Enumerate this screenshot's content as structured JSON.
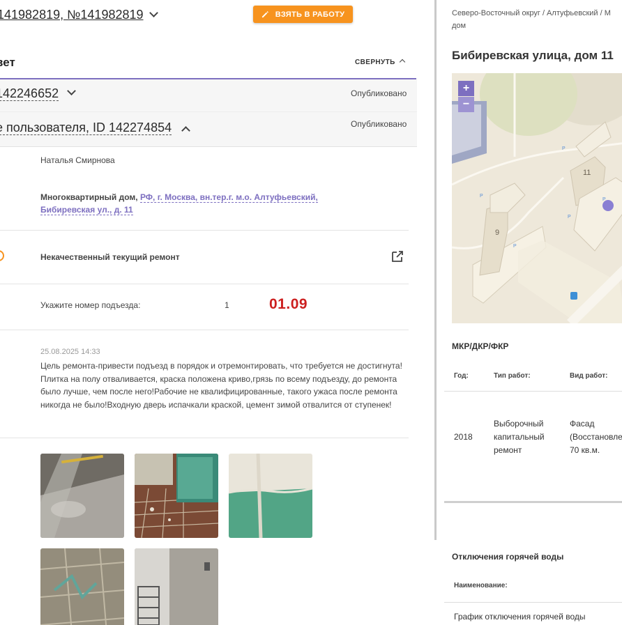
{
  "header": {
    "title": "141982819, №141982819",
    "take_button": "ВЗЯТЬ В РАБОТУ"
  },
  "section": {
    "title": "вет",
    "collapse_label": "СВЕРНУТЬ"
  },
  "items": [
    {
      "id_text": "142246652",
      "status": "Опубликовано"
    },
    {
      "id_text": "е пользователя, ID 142274854",
      "status": "Опубликовано"
    }
  ],
  "details": {
    "author": "Наталья Смирнова",
    "object_type": "Многоквартирный дом,",
    "address_line1": "РФ, г. Москва, вн.тер.г. м.о. Алтуфьевский,",
    "address_line2": "Бибиревская ул., д. 11",
    "category": "Некачественный текущий ремонт",
    "entrance_question": "Укажите номер подъезда:",
    "entrance_answer": "1",
    "stamp": "01.09",
    "comment_date": "25.08.2025 14:33",
    "comment_text": "Цель ремонта-привести подъезд в порядок и отремонтировать, что требуется не достигнута!Плитка на полу отваливается, краска положена криво,грязь по всему подъезду, до ремонта было лучше, чем после него!Рабочие не квалифицированные, такого ужаса после ремонта никогда не было!Входную дверь испачкали краской, цемент зимой отвалится от ступенек!"
  },
  "right": {
    "breadcrumb_line1": "Северо-Восточный округ / Алтуфьевский / М",
    "breadcrumb_line2": "дом",
    "address": "Бибиревская улица, дом 11",
    "map": {
      "zoom_in": "+",
      "zoom_out": "−",
      "building_labels": [
        "9",
        "11"
      ],
      "parking_label": "P"
    },
    "repairs_title": "МКР/ДКР/ФКР",
    "repairs_headers": [
      "Год:",
      "Тип работ:",
      "Вид работ:"
    ],
    "repairs_row": {
      "year": "2018",
      "type": [
        "Выборочный",
        "капитальный",
        "ремонт"
      ],
      "kind": [
        "Фасад",
        "(Восстановле",
        "70 кв.м."
      ]
    },
    "hotwater_title": "Отключения горячей воды",
    "hotwater_header": "Наименование:",
    "hotwater_row": "График отключения горячей воды"
  },
  "colors": {
    "accent": "#7d6fc0",
    "orange": "#f7931e",
    "red": "#cc1f1f"
  }
}
